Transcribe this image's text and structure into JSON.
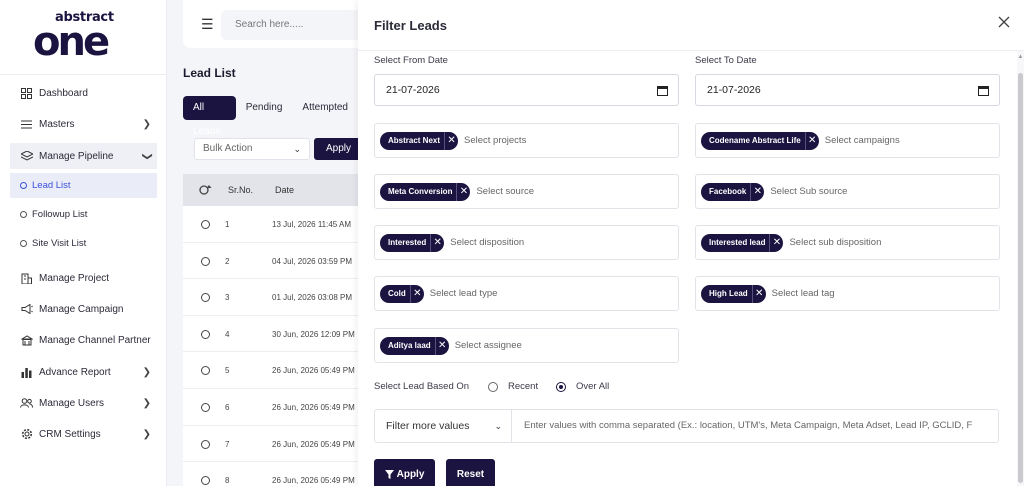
{
  "brand": {
    "top": "abstract",
    "bottom": "one"
  },
  "sidebar": {
    "items": [
      {
        "label": "Dashboard",
        "icon": "grid-icon",
        "chevron": false
      },
      {
        "label": "Masters",
        "icon": "list-icon",
        "chevron": true
      },
      {
        "label": "Manage Pipeline",
        "icon": "pipeline-icon",
        "chevron": true,
        "expanded": true
      },
      {
        "label": "Manage Project",
        "icon": "building-icon",
        "chevron": false
      },
      {
        "label": "Manage Campaign",
        "icon": "megaphone-icon",
        "chevron": false
      },
      {
        "label": "Manage Channel Partner",
        "icon": "partner-icon",
        "chevron": false
      },
      {
        "label": "Advance Report",
        "icon": "bar-chart-icon",
        "chevron": true
      },
      {
        "label": "Manage Users",
        "icon": "users-icon",
        "chevron": true
      },
      {
        "label": "CRM Settings",
        "icon": "gear-icon",
        "chevron": true
      }
    ],
    "sub_items": [
      {
        "label": "Lead List",
        "active": true
      },
      {
        "label": "Followup List",
        "active": false
      },
      {
        "label": "Site Visit List",
        "active": false
      }
    ]
  },
  "header": {
    "search_placeholder": "Search here....."
  },
  "leads": {
    "title": "Lead List",
    "tabs": [
      "All Leads",
      "Pending",
      "Attempted"
    ],
    "bulk_action": "Bulk Action",
    "apply": "Apply",
    "columns": [
      "Sr.No.",
      "Date"
    ],
    "rows": [
      {
        "sr": "1",
        "date": "13 Jul, 2026 11:45 AM"
      },
      {
        "sr": "2",
        "date": "04 Jul, 2026 03:59 PM"
      },
      {
        "sr": "3",
        "date": "01 Jul, 2026 03:08 PM"
      },
      {
        "sr": "4",
        "date": "30 Jun, 2026 12:09 PM"
      },
      {
        "sr": "5",
        "date": "26 Jun, 2026 05:49 PM"
      },
      {
        "sr": "6",
        "date": "26 Jun, 2026 05:49 PM"
      },
      {
        "sr": "7",
        "date": "26 Jun, 2026 05:49 PM"
      },
      {
        "sr": "8",
        "date": "26 Jun, 2026 05:49 PM"
      }
    ]
  },
  "filter": {
    "title": "Filter Leads",
    "from_date_label": "Select From Date",
    "from_date_value": "21-07-2026",
    "to_date_label": "Select To Date",
    "to_date_value": "21-07-2026",
    "fields": [
      {
        "chip": "Abstract Next",
        "placeholder": "Select projects"
      },
      {
        "chip": "Codename Abstract Life",
        "placeholder": "Select campaigns"
      },
      {
        "chip": "Meta Conversion",
        "placeholder": "Select source"
      },
      {
        "chip": "Facebook",
        "placeholder": "Select Sub source"
      },
      {
        "chip": "Interested",
        "placeholder": "Select disposition"
      },
      {
        "chip": "Interested lead",
        "placeholder": "Select sub disposition"
      },
      {
        "chip": "Cold",
        "placeholder": "Select lead type"
      },
      {
        "chip": "High Lead",
        "placeholder": "Select lead tag"
      },
      {
        "chip": "Aditya laad",
        "placeholder": "Select assignee"
      }
    ],
    "based_on_label": "Select Lead Based On",
    "option_recent": "Recent",
    "option_overall": "Over All",
    "selected_option": "Over All",
    "filter_more": "Filter more values",
    "more_placeholder": "Enter values with comma separated (Ex.: location, UTM's, Meta Campaign, Meta Adset, Lead IP, GCLID, F",
    "apply_label": "Apply",
    "reset_label": "Reset"
  },
  "colors": {
    "brand_dark": "#1b1340",
    "active_blue": "#3b4fd8"
  }
}
